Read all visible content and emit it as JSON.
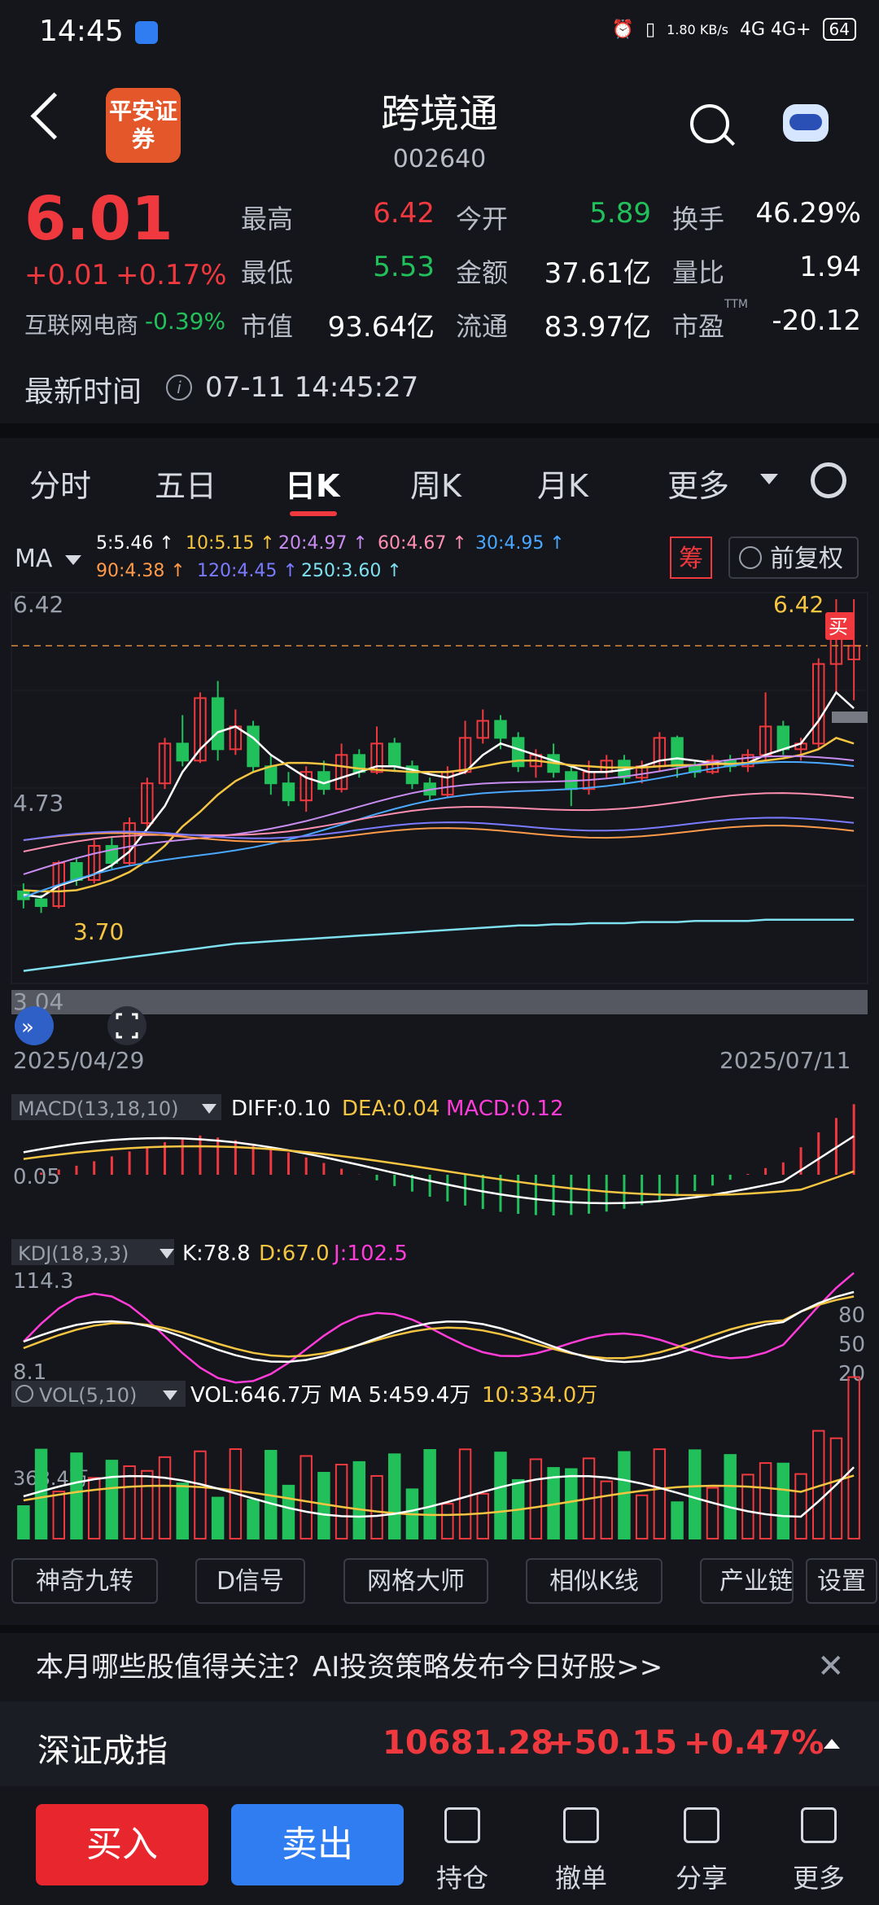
{
  "status_bar": {
    "time": "14:45",
    "network_speed": "1.80 KB/s",
    "network": "4G 4G+",
    "battery": "64"
  },
  "header": {
    "broker_logo_text": "平安证券",
    "stock_name": "跨境通",
    "stock_code": "002640"
  },
  "quote": {
    "price": "6.01",
    "change": "+0.01",
    "change_pct": "+0.17%",
    "sector_name": "互联网电商",
    "sector_change": "-0.39%",
    "rows": [
      [
        {
          "label": "最高",
          "value": "6.42",
          "color": "#f0393f"
        },
        {
          "label": "今开",
          "value": "5.89",
          "color": "#22c05a"
        },
        {
          "label": "换手",
          "value": "46.29%",
          "color": "#ffffff"
        }
      ],
      [
        {
          "label": "最低",
          "value": "5.53",
          "color": "#22c05a"
        },
        {
          "label": "金额",
          "value": "37.61亿",
          "color": "#ffffff"
        },
        {
          "label": "量比",
          "value": "1.94",
          "color": "#ffffff"
        }
      ],
      [
        {
          "label": "市值",
          "value": "93.64亿",
          "color": "#ffffff"
        },
        {
          "label": "流通",
          "value": "83.97亿",
          "color": "#ffffff"
        },
        {
          "label": "市盈TTM",
          "value": "-20.12",
          "color": "#ffffff"
        }
      ]
    ],
    "update_label": "最新时间",
    "update_time": "07-11 14:45:27"
  },
  "tabs": [
    "分时",
    "五日",
    "日K",
    "周K",
    "月K",
    "更多"
  ],
  "active_tab": "日K",
  "chart": {
    "ma_label": "MA",
    "ma_items": [
      {
        "text": "5:5.46",
        "color": "#ffffff"
      },
      {
        "text": "10:5.15",
        "color": "#f5c542"
      },
      {
        "text": "20:4.97",
        "color": "#c98cf0"
      },
      {
        "text": "60:4.67",
        "color": "#ff8fb0"
      },
      {
        "text": "30:4.95",
        "color": "#4aa8ff"
      },
      {
        "text": "90:4.38",
        "color": "#ff9a4a"
      },
      {
        "text": "120:4.45",
        "color": "#7b7bff"
      },
      {
        "text": "250:3.60",
        "color": "#7fe0f0"
      }
    ],
    "chips_badge": "筹",
    "adjust_label": "前复权",
    "price_high_label": "6.42",
    "price_mid_label": "4.73",
    "price_low_label": "3.04",
    "marker_high": "6.42",
    "marker_low": "3.70",
    "buy_marker": "买",
    "date_start": "2025/04/29",
    "date_end": "2025/07/11",
    "macd_label": "MACD(13,18,10)",
    "macd_diff": "DIFF:0.10",
    "macd_dea": "DEA:0.04",
    "macd_val": "MACD:0.12",
    "macd_axis": "0.05",
    "kdj_label": "KDJ(18,3,3)",
    "kdj_k": "K:78.8",
    "kdj_d": "D:67.0",
    "kdj_j": "J:102.5",
    "kdj_top": "114.3",
    "kdj_bottom": "8.1",
    "kdj_levels": [
      "80",
      "50",
      "20"
    ],
    "vol_label": "VOL(5,10)",
    "vol_val": "VOL:646.7万",
    "vol_ma5": "MA 5:459.4万",
    "vol_ma10": "10:334.0万",
    "vol_axis": "368.4万"
  },
  "chart_data": {
    "type": "candlestick",
    "x_start": "2025/04/29",
    "x_end": "2025/07/11",
    "ylim": [
      3.04,
      6.42
    ],
    "candles": [
      {
        "o": 3.85,
        "c": 3.78,
        "h": 3.92,
        "l": 3.7
      },
      {
        "o": 3.78,
        "c": 3.72,
        "h": 3.82,
        "l": 3.66
      },
      {
        "o": 3.72,
        "c": 4.1,
        "h": 4.12,
        "l": 3.7
      },
      {
        "o": 4.1,
        "c": 3.95,
        "h": 4.15,
        "l": 3.9
      },
      {
        "o": 3.95,
        "c": 4.25,
        "h": 4.3,
        "l": 3.92
      },
      {
        "o": 4.25,
        "c": 4.1,
        "h": 4.32,
        "l": 4.05
      },
      {
        "o": 4.1,
        "c": 4.45,
        "h": 4.5,
        "l": 4.08
      },
      {
        "o": 4.45,
        "c": 4.8,
        "h": 4.85,
        "l": 4.4
      },
      {
        "o": 4.8,
        "c": 5.15,
        "h": 5.2,
        "l": 4.75
      },
      {
        "o": 5.15,
        "c": 5.0,
        "h": 5.4,
        "l": 4.95
      },
      {
        "o": 5.0,
        "c": 5.55,
        "h": 5.6,
        "l": 4.98
      },
      {
        "o": 5.55,
        "c": 5.1,
        "h": 5.7,
        "l": 5.0
      },
      {
        "o": 5.1,
        "c": 5.3,
        "h": 5.45,
        "l": 5.05
      },
      {
        "o": 5.3,
        "c": 4.95,
        "h": 5.35,
        "l": 4.9
      },
      {
        "o": 4.95,
        "c": 4.8,
        "h": 5.05,
        "l": 4.7
      },
      {
        "o": 4.8,
        "c": 4.65,
        "h": 4.9,
        "l": 4.6
      },
      {
        "o": 4.65,
        "c": 4.9,
        "h": 4.95,
        "l": 4.55
      },
      {
        "o": 4.9,
        "c": 4.75,
        "h": 5.0,
        "l": 4.7
      },
      {
        "o": 4.75,
        "c": 5.05,
        "h": 5.15,
        "l": 4.72
      },
      {
        "o": 5.05,
        "c": 4.9,
        "h": 5.1,
        "l": 4.85
      },
      {
        "o": 4.9,
        "c": 5.15,
        "h": 5.3,
        "l": 4.88
      },
      {
        "o": 5.15,
        "c": 4.95,
        "h": 5.2,
        "l": 4.9
      },
      {
        "o": 4.95,
        "c": 4.8,
        "h": 5.0,
        "l": 4.75
      },
      {
        "o": 4.8,
        "c": 4.7,
        "h": 4.85,
        "l": 4.65
      },
      {
        "o": 4.7,
        "c": 4.9,
        "h": 4.95,
        "l": 4.68
      },
      {
        "o": 4.9,
        "c": 5.2,
        "h": 5.35,
        "l": 4.88
      },
      {
        "o": 5.2,
        "c": 5.35,
        "h": 5.45,
        "l": 5.15
      },
      {
        "o": 5.35,
        "c": 5.2,
        "h": 5.4,
        "l": 5.1
      },
      {
        "o": 5.2,
        "c": 4.95,
        "h": 5.25,
        "l": 4.9
      },
      {
        "o": 4.95,
        "c": 5.05,
        "h": 5.1,
        "l": 4.85
      },
      {
        "o": 5.05,
        "c": 4.9,
        "h": 5.15,
        "l": 4.85
      },
      {
        "o": 4.9,
        "c": 4.75,
        "h": 4.95,
        "l": 4.6
      },
      {
        "o": 4.75,
        "c": 4.9,
        "h": 5.0,
        "l": 4.7
      },
      {
        "o": 4.9,
        "c": 5.0,
        "h": 5.05,
        "l": 4.85
      },
      {
        "o": 5.0,
        "c": 4.85,
        "h": 5.05,
        "l": 4.8
      },
      {
        "o": 4.85,
        "c": 4.95,
        "h": 5.0,
        "l": 4.8
      },
      {
        "o": 4.95,
        "c": 5.2,
        "h": 5.25,
        "l": 4.9
      },
      {
        "o": 5.2,
        "c": 4.95,
        "h": 5.22,
        "l": 4.85
      },
      {
        "o": 4.95,
        "c": 4.9,
        "h": 5.0,
        "l": 4.85
      },
      {
        "o": 4.9,
        "c": 5.0,
        "h": 5.05,
        "l": 4.88
      },
      {
        "o": 5.0,
        "c": 4.95,
        "h": 5.05,
        "l": 4.9
      },
      {
        "o": 4.95,
        "c": 5.05,
        "h": 5.1,
        "l": 4.9
      },
      {
        "o": 5.05,
        "c": 5.3,
        "h": 5.6,
        "l": 5.0
      },
      {
        "o": 5.3,
        "c": 5.1,
        "h": 5.35,
        "l": 5.05
      },
      {
        "o": 5.1,
        "c": 5.15,
        "h": 5.2,
        "l": 5.0
      },
      {
        "o": 5.15,
        "c": 5.85,
        "h": 5.9,
        "l": 5.1
      },
      {
        "o": 5.85,
        "c": 6.1,
        "h": 6.42,
        "l": 5.6
      },
      {
        "o": 5.89,
        "c": 6.01,
        "h": 6.42,
        "l": 5.53
      }
    ],
    "ma_series": [
      {
        "name": "MA5",
        "values": [
          3.82,
          3.8,
          3.9,
          3.95,
          4.0,
          4.08,
          4.2,
          4.4,
          4.6,
          4.9,
          5.1,
          5.25,
          5.3,
          5.2,
          5.05,
          4.95,
          4.85,
          4.8,
          4.85,
          4.9,
          4.95,
          4.95,
          4.92,
          4.88,
          4.85,
          4.9,
          5.05,
          5.15,
          5.1,
          5.05,
          5.0,
          4.95,
          4.9,
          4.9,
          4.92,
          4.95,
          5.0,
          5.02,
          5.0,
          4.98,
          4.97,
          4.98,
          5.05,
          5.1,
          5.15,
          5.35,
          5.6,
          5.46
        ]
      },
      {
        "name": "MA10",
        "values": [
          3.86,
          3.85,
          3.85,
          3.86,
          3.9,
          3.95,
          4.02,
          4.12,
          4.25,
          4.42,
          4.55,
          4.7,
          4.82,
          4.9,
          4.95,
          4.98,
          4.98,
          4.97,
          4.95,
          4.93,
          4.92,
          4.91,
          4.9,
          4.9,
          4.9,
          4.92,
          4.95,
          4.98,
          5.0,
          5.0,
          4.98,
          4.96,
          4.95,
          4.94,
          4.94,
          4.94,
          4.95,
          4.96,
          4.96,
          4.97,
          4.97,
          4.98,
          5.0,
          5.02,
          5.05,
          5.1,
          5.2,
          5.15
        ]
      },
      {
        "name": "MA250",
        "values": [
          3.15,
          3.17,
          3.19,
          3.21,
          3.23,
          3.25,
          3.27,
          3.29,
          3.31,
          3.33,
          3.35,
          3.37,
          3.39,
          3.4,
          3.41,
          3.42,
          3.43,
          3.44,
          3.45,
          3.46,
          3.47,
          3.48,
          3.49,
          3.5,
          3.51,
          3.52,
          3.53,
          3.54,
          3.55,
          3.55,
          3.56,
          3.56,
          3.57,
          3.57,
          3.57,
          3.58,
          3.58,
          3.58,
          3.59,
          3.59,
          3.59,
          3.59,
          3.6,
          3.6,
          3.6,
          3.6,
          3.6,
          3.6
        ]
      }
    ],
    "macd": {
      "diff": 0.1,
      "dea": 0.04,
      "macd": 0.12
    },
    "kdj": {
      "k": 78.8,
      "d": 67.0,
      "j": 102.5
    },
    "volume": {
      "vol": "646.7万",
      "ma5": "459.4万",
      "ma10": "334.0万"
    }
  },
  "tools": [
    "神奇九转",
    "D信号",
    "网格大师",
    "相似K线",
    "产业链",
    "设置"
  ],
  "promo_text": "本月哪些股值得关注？AI投资策略发布今日好股>>",
  "index": {
    "name": "深证成指",
    "value": "10681.28",
    "change": "+50.15",
    "pct": "+0.47%"
  },
  "bottom_nav": {
    "buy": "买入",
    "sell": "卖出",
    "items": [
      "持仓",
      "撤单",
      "分享",
      "更多"
    ]
  },
  "colors": {
    "up": "#f0393f",
    "down": "#22c05a",
    "background": "#14161c",
    "accent_blue": "#2f7df0"
  }
}
